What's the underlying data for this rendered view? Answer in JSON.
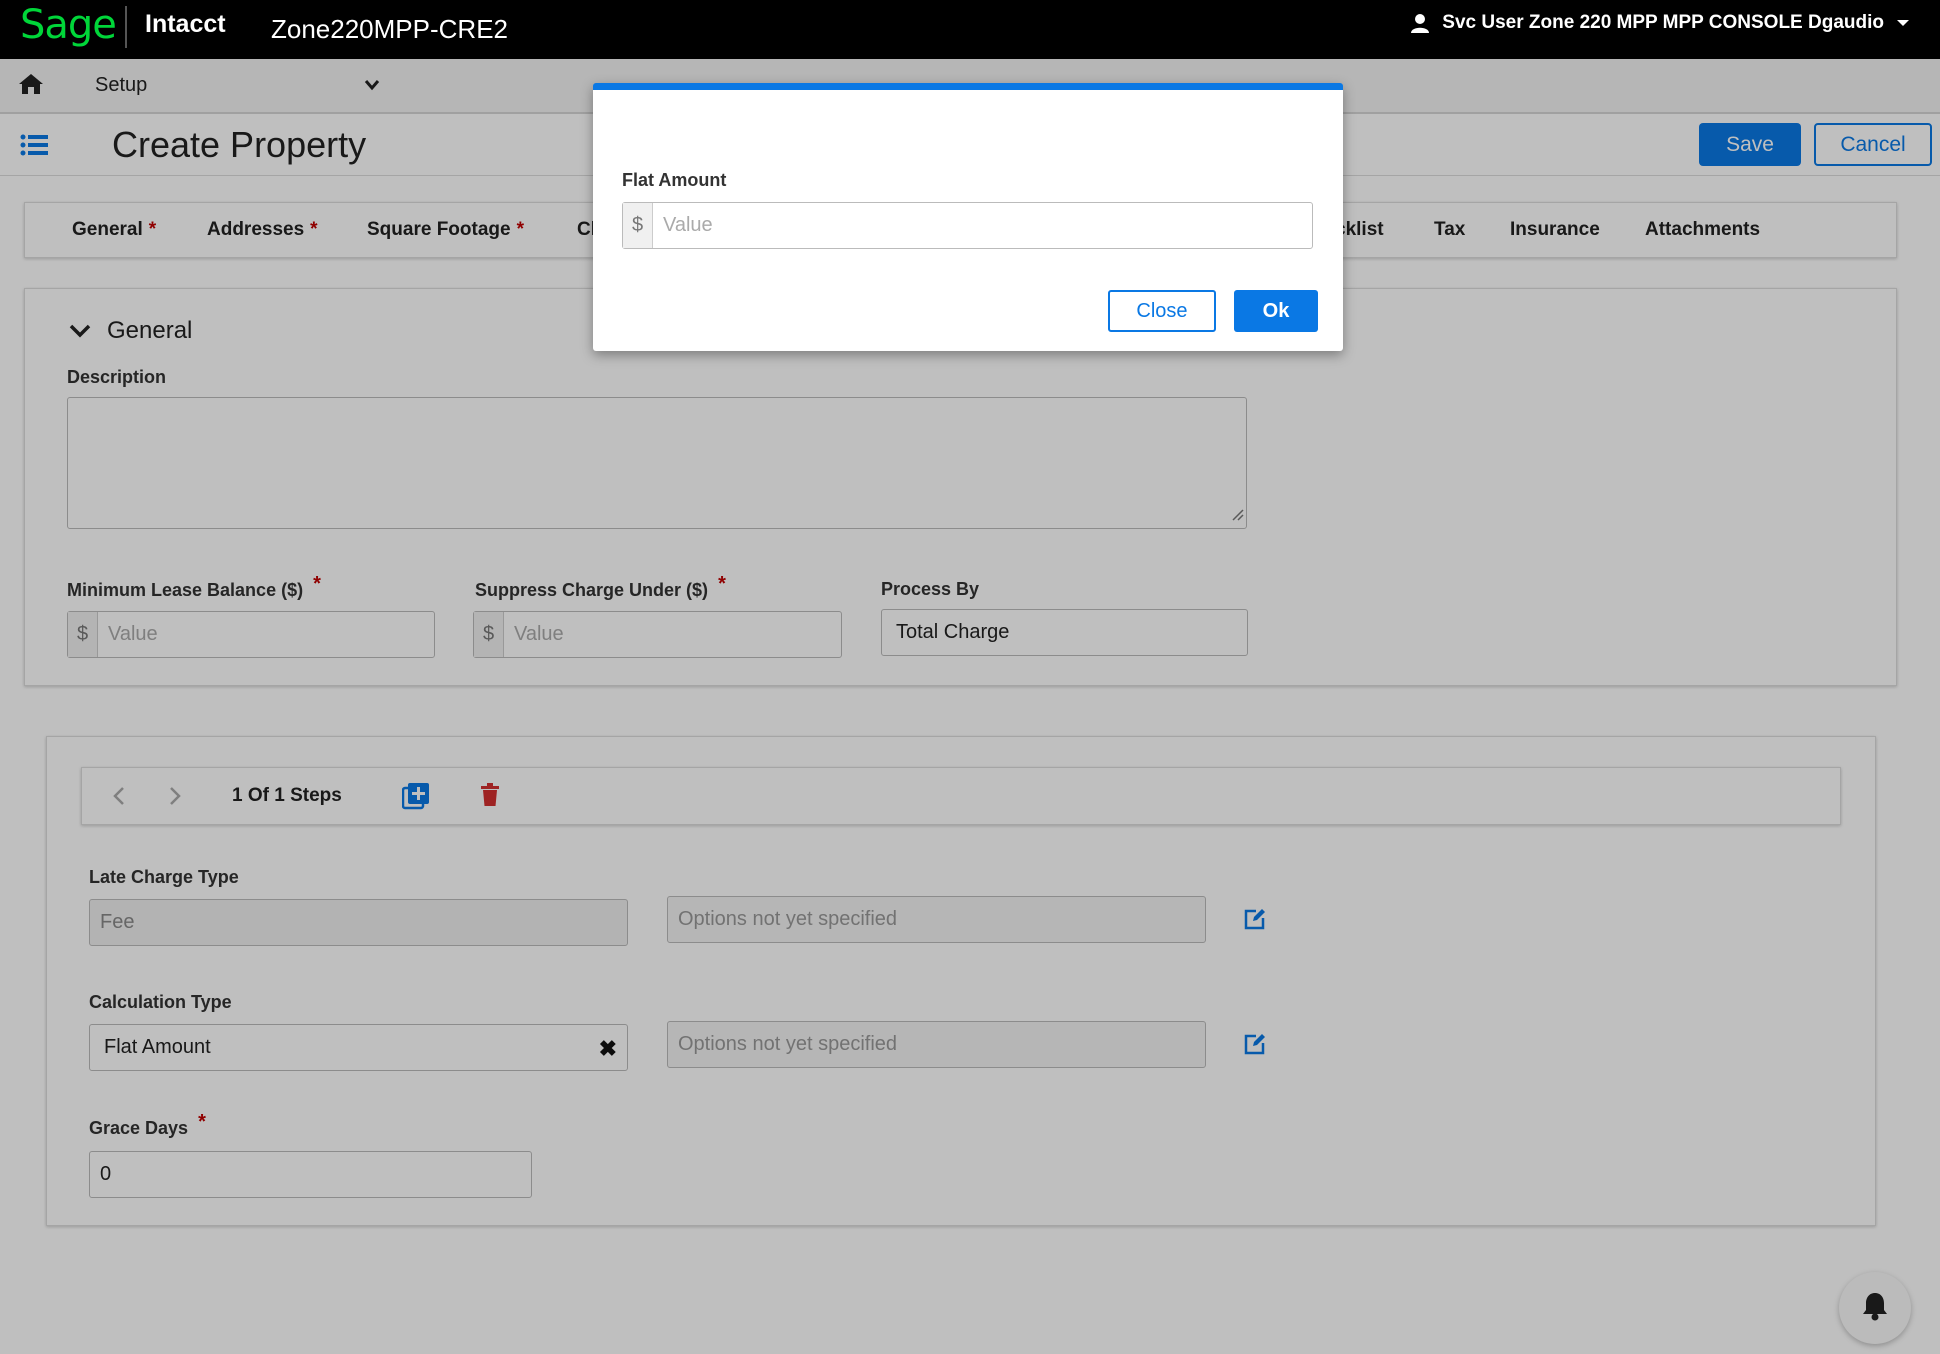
{
  "topbar": {
    "logo": "Sage",
    "product": "Intacct",
    "company": "Zone220MPP-CRE2",
    "user": "Svc User Zone 220 MPP MPP CONSOLE Dgaudio",
    "icons": [
      "user-icon",
      "caret-down-icon"
    ]
  },
  "navbar": {
    "module": "Setup",
    "icons": [
      "home-icon",
      "chevron-down-icon"
    ]
  },
  "header": {
    "title": "Create Property",
    "save_label": "Save",
    "cancel_label": "Cancel"
  },
  "tabs": [
    {
      "label": "General",
      "required": "*"
    },
    {
      "label": "Addresses",
      "required": "*"
    },
    {
      "label": "Square Footage",
      "required": "*"
    },
    {
      "label": "Cl"
    },
    {
      "label": "cklist"
    },
    {
      "label": "Tax"
    },
    {
      "label": "Insurance"
    },
    {
      "label": "Attachments"
    }
  ],
  "general": {
    "section_title": "General",
    "description_label": "Description",
    "min_lease_label": "Minimum Lease Balance ($)",
    "suppress_label": "Suppress Charge Under ($)",
    "process_by_label": "Process By",
    "process_by_value": "Total Charge",
    "required_mark": "*",
    "currency_symbol": "$",
    "value_placeholder": "Value"
  },
  "steps": {
    "count_text": "1 Of 1 Steps",
    "late_charge_type_label": "Late Charge Type",
    "late_charge_type_value": "Fee",
    "options_placeholder": "Options not yet specified",
    "calculation_type_label": "Calculation Type",
    "calculation_type_value": "Flat Amount",
    "clear_symbol": "✖",
    "grace_days_label": "Grace Days",
    "grace_days_value": "0",
    "required_mark": "*"
  },
  "modal": {
    "field_label": "Flat Amount",
    "currency_symbol": "$",
    "placeholder": "Value",
    "close_label": "Close",
    "ok_label": "Ok"
  },
  "colors": {
    "accent": "#0a78e4",
    "brand_green": "#00d639",
    "required_red": "#c00000",
    "delete_red": "#d32f2f"
  }
}
